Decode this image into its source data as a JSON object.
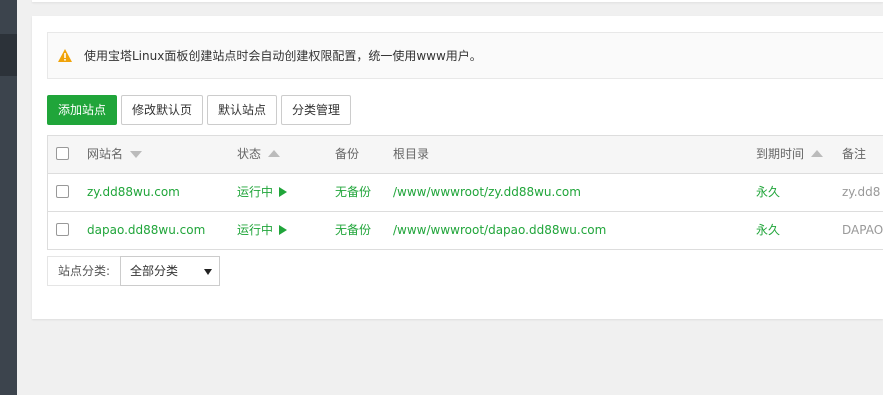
{
  "notice": "使用宝塔Linux面板创建站点时会自动创建权限配置，统一使用www用户。",
  "toolbar": {
    "add_site": "添加站点",
    "edit_default_page": "修改默认页",
    "default_site": "默认站点",
    "category_manage": "分类管理"
  },
  "table": {
    "headers": {
      "name": "网站名",
      "status": "状态",
      "backup": "备份",
      "root": "根目录",
      "expire": "到期时间",
      "note": "备注"
    },
    "rows": [
      {
        "name": "zy.dd88wu.com",
        "status": "运行中",
        "backup": "无备份",
        "root": "/www/wwwroot/zy.dd88wu.com",
        "expire": "永久",
        "note": "zy.dd8"
      },
      {
        "name": "dapao.dd88wu.com",
        "status": "运行中",
        "backup": "无备份",
        "root": "/www/wwwroot/dapao.dd88wu.com",
        "expire": "永久",
        "note": "DAPAO"
      }
    ]
  },
  "filter": {
    "label": "站点分类:",
    "selected": "全部分类"
  },
  "colors": {
    "accent": "#20a53a",
    "sidebar": "#3c444d",
    "warning": "#f0a30a"
  }
}
